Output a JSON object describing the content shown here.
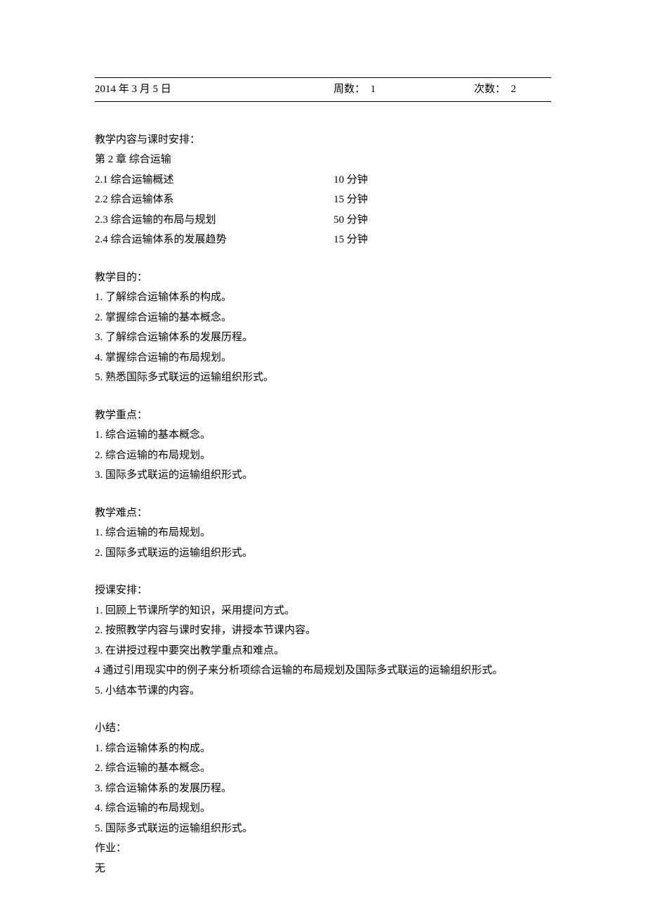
{
  "header": {
    "date": "2014 年 3 月 5 日",
    "week_label": "周数：",
    "week_value": "1",
    "count_label": "次数：",
    "count_value": "2"
  },
  "schedule": {
    "title": "教学内容与课时安排：",
    "chapter": "第 2 章 综合运输",
    "items": [
      {
        "label": "2.1 综合运输概述",
        "time": "10 分钟"
      },
      {
        "label": "2.2 综合运输体系",
        "time": "15 分钟"
      },
      {
        "label": "2.3 综合运输的布局与规划",
        "time": "50 分钟"
      },
      {
        "label": "2.4 综合运输体系的发展趋势",
        "time": "15 分钟"
      }
    ]
  },
  "objectives": {
    "title": "教学目的：",
    "items": [
      "1. 了解综合运输体系的构成。",
      "2. 掌握综合运输的基本概念。",
      "3. 了解综合运输体系的发展历程。",
      "4. 掌握综合运输的布局规划。",
      "5. 熟悉国际多式联运的运输组织形式。"
    ]
  },
  "keypoints": {
    "title": "教学重点：",
    "items": [
      "1. 综合运输的基本概念。",
      "2. 综合运输的布局规划。",
      "3. 国际多式联运的运输组织形式。"
    ]
  },
  "difficulties": {
    "title": "教学难点：",
    "items": [
      "1. 综合运输的布局规划。",
      "2. 国际多式联运的运输组织形式。"
    ]
  },
  "arrangement": {
    "title": "授课安排：",
    "items": [
      "1. 回顾上节课所学的知识，采用提问方式。",
      "2. 按照教学内容与课时安排，讲授本节课内容。",
      "3. 在讲授过程中要突出教学重点和难点。",
      "4 通过引用现实中的例子来分析项综合运输的布局规划及国际多式联运的运输组织形式。",
      "5. 小结本节课的内容。"
    ]
  },
  "summary": {
    "title": "小结：",
    "items": [
      "1. 综合运输体系的构成。",
      "2. 综合运输的基本概念。",
      "3. 综合运输体系的发展历程。",
      "4. 综合运输的布局规划。",
      "5. 国际多式联运的运输组织形式。"
    ]
  },
  "homework": {
    "title": "作业：",
    "content": "无"
  }
}
